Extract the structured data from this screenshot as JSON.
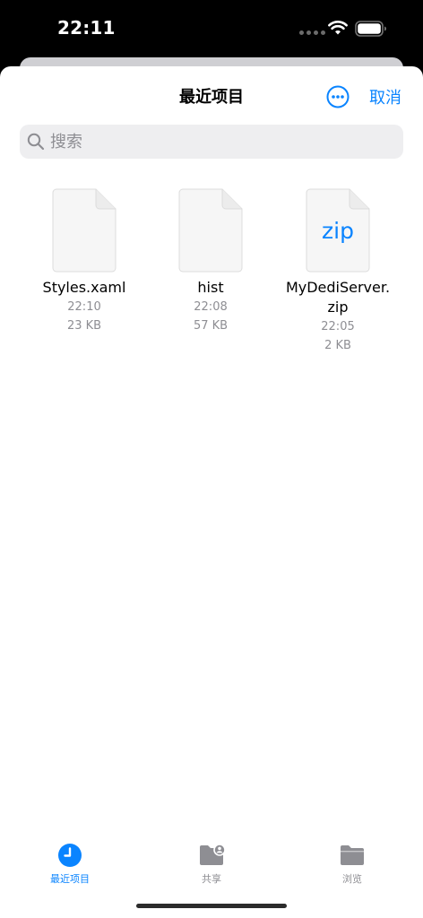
{
  "status_bar": {
    "time": "22:11"
  },
  "header": {
    "title": "最近项目",
    "cancel_label": "取消",
    "more_icon": "ellipsis-circle-icon"
  },
  "search": {
    "placeholder": "搜索",
    "value": ""
  },
  "files": [
    {
      "name": "Styles.xaml",
      "time": "22:10",
      "size": "23 KB",
      "icon": "document-icon",
      "badge": ""
    },
    {
      "name": "hist",
      "time": "22:08",
      "size": "57 KB",
      "icon": "document-icon",
      "badge": ""
    },
    {
      "name": "MyDediServer.\nzip",
      "time": "22:05",
      "size": "2 KB",
      "icon": "zip-document-icon",
      "badge": "zip"
    }
  ],
  "tab_bar": {
    "tabs": [
      {
        "label": "最近项目",
        "icon": "clock-icon",
        "active": true
      },
      {
        "label": "共享",
        "icon": "shared-folder-icon",
        "active": false
      },
      {
        "label": "浏览",
        "icon": "folder-icon",
        "active": false
      }
    ]
  },
  "colors": {
    "accent": "#0a84ff",
    "secondary_text": "#8e8e93",
    "search_background": "#eeeef0"
  }
}
